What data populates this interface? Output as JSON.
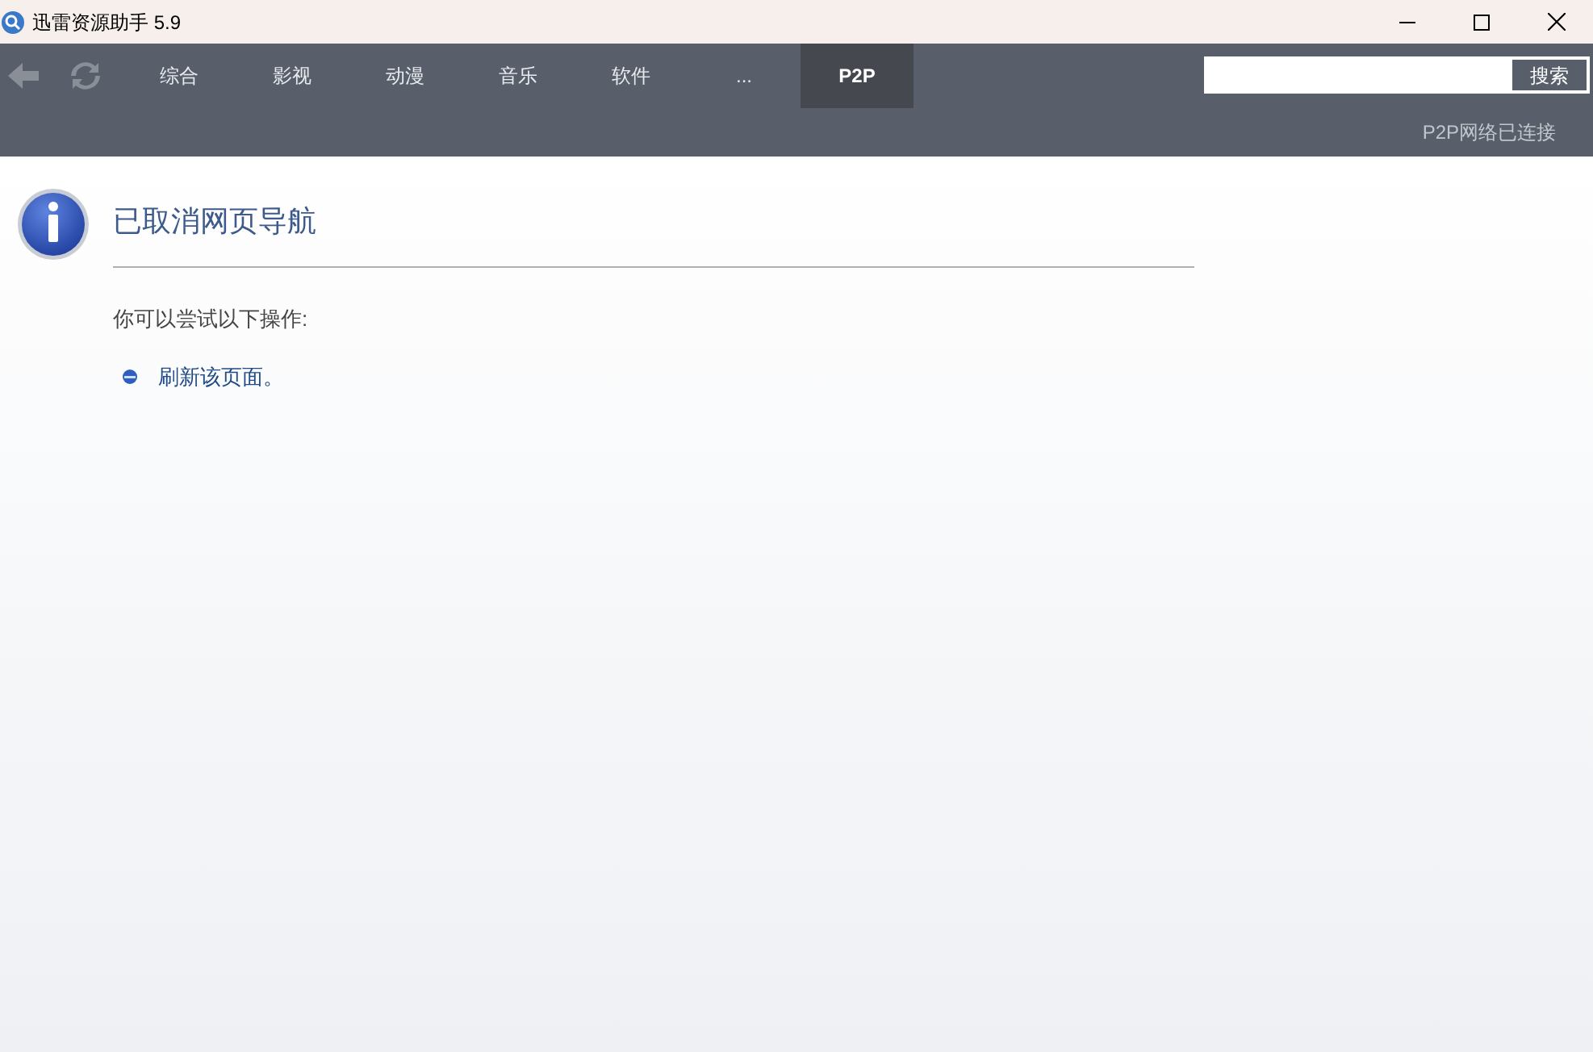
{
  "window": {
    "title": "迅雷资源助手 5.9"
  },
  "tabs": [
    {
      "label": "综合",
      "selected": false
    },
    {
      "label": "影视",
      "selected": false
    },
    {
      "label": "动漫",
      "selected": false
    },
    {
      "label": "音乐",
      "selected": false
    },
    {
      "label": "软件",
      "selected": false
    },
    {
      "label": "...",
      "selected": false
    },
    {
      "label": "P2P",
      "selected": true
    }
  ],
  "search": {
    "button": "搜索"
  },
  "status": "P2P网络已连接",
  "page": {
    "heading": "已取消网页导航",
    "intro": "你可以尝试以下操作:",
    "actions": [
      "刷新该页面。"
    ]
  }
}
